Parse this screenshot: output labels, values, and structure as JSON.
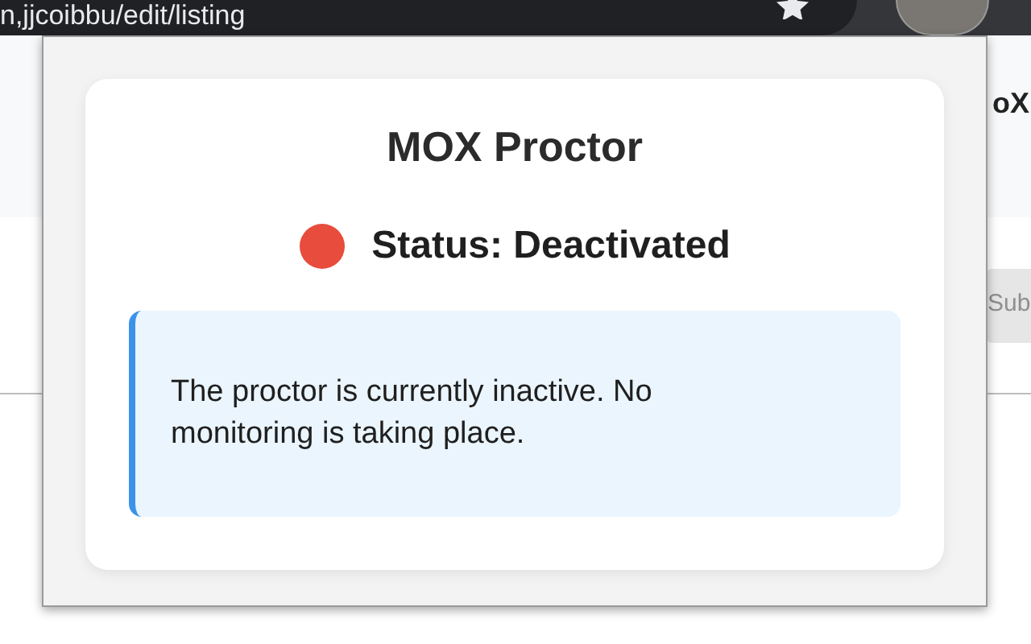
{
  "browser": {
    "url": "n,jjcoibbu/edit/listing"
  },
  "page": {
    "heading_fragment": "oX",
    "button_fragment": "Sub"
  },
  "popup": {
    "title": "MOX Proctor",
    "status": {
      "label": "Status: Deactivated",
      "color": "#e74c3c"
    },
    "notice": "The proctor is currently inactive. No monitoring is taking place."
  }
}
